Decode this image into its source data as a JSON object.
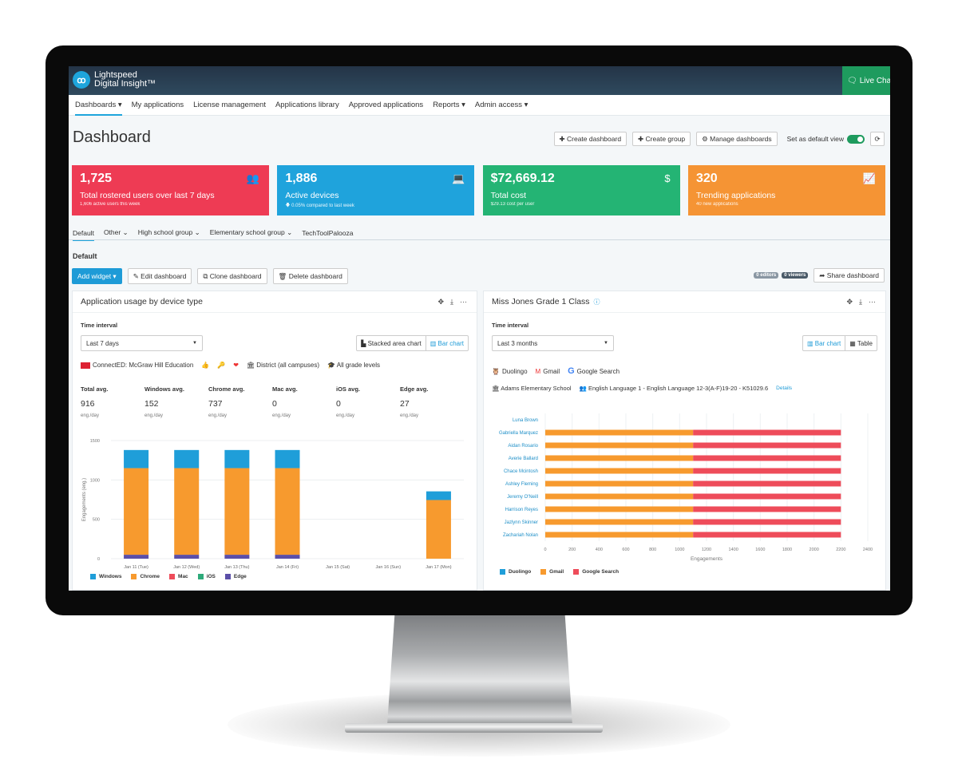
{
  "app": {
    "brand_line1": "Lightspeed",
    "brand_line2": "Digital Insight™",
    "logo_glyph": "ꝏ",
    "live_chat": "Live Chat",
    "live_chat_icon": "chat-icon"
  },
  "nav": {
    "items": [
      {
        "label": "Dashboards ▾",
        "active": true
      },
      {
        "label": "My applications"
      },
      {
        "label": "License management"
      },
      {
        "label": "Applications library"
      },
      {
        "label": "Approved applications"
      },
      {
        "label": "Reports ▾"
      },
      {
        "label": "Admin access ▾"
      }
    ]
  },
  "header": {
    "title": "Dashboard",
    "create_dashboard": "✚ Create dashboard",
    "create_group": "✚ Create group",
    "manage_dashboards": "⚙ Manage dashboards",
    "default_view_label": "Set as default view",
    "default_view_on": true,
    "refresh_icon": "⟳"
  },
  "cards": [
    {
      "value": "1,725",
      "label": "Total rostered users over last 7 days",
      "sub": "1,606 active users this week",
      "icon": "👥",
      "color": "#ee3b54"
    },
    {
      "value": "1,886",
      "label": "Active devices",
      "sub": "🡇 0.05% compared to last week",
      "icon": "💻",
      "color": "#1fa3dc"
    },
    {
      "value": "$72,669.12",
      "label": "Total cost",
      "sub": "$29.13 cost per user",
      "icon": "$",
      "color": "#24b474"
    },
    {
      "value": "320",
      "label": "Trending applications",
      "sub": "40 new applications",
      "icon": "📈",
      "color": "#f59434"
    }
  ],
  "dashboard_tabs": [
    {
      "label": "Default",
      "active": true
    },
    {
      "label": "Other ⌄"
    },
    {
      "label": "High school group ⌄"
    },
    {
      "label": "Elementary school group ⌄"
    },
    {
      "label": "TechToolPalooza"
    }
  ],
  "section": {
    "title": "Default",
    "add_widget": "Add widget ▾",
    "edit_dashboard": "✎ Edit dashboard",
    "clone_dashboard": "⧉ Clone dashboard",
    "delete_dashboard": "🗑 Delete dashboard",
    "editors": "0 editors",
    "viewers": "0 viewers",
    "share_dashboard": "➦ Share dashboard"
  },
  "panel1": {
    "title": "Application usage by device type",
    "tools": [
      "✥",
      "⤓",
      "···"
    ],
    "time_interval_label": "Time interval",
    "time_interval_value": "Last 7 days",
    "view_stacked": "▙ Stacked area chart",
    "view_bar": "▥ Bar chart",
    "active_view": "bar",
    "app_name": "ConnectED: McGraw Hill Education",
    "scope": "🏛 District (all campuses)",
    "grades": "🎓 All grade levels",
    "stats": [
      {
        "label": "Total avg.",
        "value": "916",
        "unit": "eng./day"
      },
      {
        "label": "Windows avg.",
        "value": "152",
        "unit": "eng./day"
      },
      {
        "label": "Chrome avg.",
        "value": "737",
        "unit": "eng./day"
      },
      {
        "label": "Mac avg.",
        "value": "0",
        "unit": "eng./day"
      },
      {
        "label": "iOS avg.",
        "value": "0",
        "unit": "eng./day"
      },
      {
        "label": "Edge avg.",
        "value": "27",
        "unit": "eng./day"
      }
    ]
  },
  "panel2": {
    "title": "Miss Jones Grade 1 Class",
    "tools": [
      "✥",
      "⤓",
      "···"
    ],
    "time_interval_label": "Time interval",
    "time_interval_value": "Last 3 months",
    "view_bar": "▥ Bar chart",
    "view_table": "▦ Table",
    "active_view": "bar",
    "apps": [
      "Duolingo",
      "Gmail",
      "Google Search"
    ],
    "school": "🏛 Adams Elementary School",
    "class_name": "👥 English Language 1 - English Language 12-3(A-F)19-20 - K51029.6",
    "details_link": "Details"
  },
  "chart_data": [
    {
      "type": "bar",
      "stacked": true,
      "title": "Application usage by device type",
      "xlabel": "",
      "ylabel": "Engagements (eng.)",
      "ylim": [
        0,
        1500
      ],
      "yticks": [
        0,
        500,
        1000,
        1500
      ],
      "grid": true,
      "legend": "bottom-left",
      "categories": [
        "Jan 11 (Tue)",
        "Jan 12 (Wed)",
        "Jan 13 (Thu)",
        "Jan 14 (Fri)",
        "Jan 15 (Sat)",
        "Jan 16 (Sun)",
        "Jan 17 (Mon)"
      ],
      "series": [
        {
          "name": "Edge",
          "color": "#5b4fa8",
          "values": [
            50,
            50,
            50,
            50,
            0,
            0,
            0
          ]
        },
        {
          "name": "iOS",
          "color": "#2eaa7a",
          "values": [
            0,
            0,
            0,
            0,
            0,
            0,
            0
          ]
        },
        {
          "name": "Mac",
          "color": "#ee4c5a",
          "values": [
            0,
            0,
            0,
            0,
            0,
            0,
            0
          ]
        },
        {
          "name": "Chrome",
          "color": "#f79a2e",
          "values": [
            1100,
            1100,
            1100,
            1100,
            0,
            0,
            745
          ]
        },
        {
          "name": "Windows",
          "color": "#1f9ed9",
          "values": [
            230,
            230,
            230,
            230,
            0,
            0,
            110
          ]
        }
      ],
      "legend_order": [
        "Windows",
        "Chrome",
        "Mac",
        "iOS",
        "Edge"
      ]
    },
    {
      "type": "bar",
      "orientation": "horizontal",
      "stacked": true,
      "title": "Miss Jones Grade 1 Class",
      "xlabel": "Engagements",
      "ylabel": "",
      "xlim": [
        0,
        2400
      ],
      "xticks": [
        0,
        200,
        400,
        600,
        800,
        1000,
        1200,
        1400,
        1600,
        1800,
        2000,
        2200,
        2400
      ],
      "grid": true,
      "legend": "bottom-left",
      "categories": [
        "Luna Brown",
        "Gabriella Marquez",
        "Aidan Rosario",
        "Averie Ballard",
        "Chace Mcintosh",
        "Ashley Fleming",
        "Jeremy O'Neill",
        "Harrison Reyes",
        "Jazlynn Skinner",
        "Zachariah Nolan"
      ],
      "series": [
        {
          "name": "Duolingo",
          "color": "#1f9ed9",
          "values": [
            0,
            0,
            0,
            0,
            0,
            0,
            0,
            0,
            0,
            0
          ]
        },
        {
          "name": "Gmail",
          "color": "#f79a2e",
          "values": [
            0,
            1100,
            1100,
            1100,
            1100,
            1100,
            1100,
            1100,
            1100,
            1100
          ]
        },
        {
          "name": "Google Search",
          "color": "#ee4c5a",
          "values": [
            0,
            1100,
            1100,
            1100,
            1100,
            1100,
            1100,
            1100,
            1100,
            1100
          ]
        }
      ]
    }
  ]
}
